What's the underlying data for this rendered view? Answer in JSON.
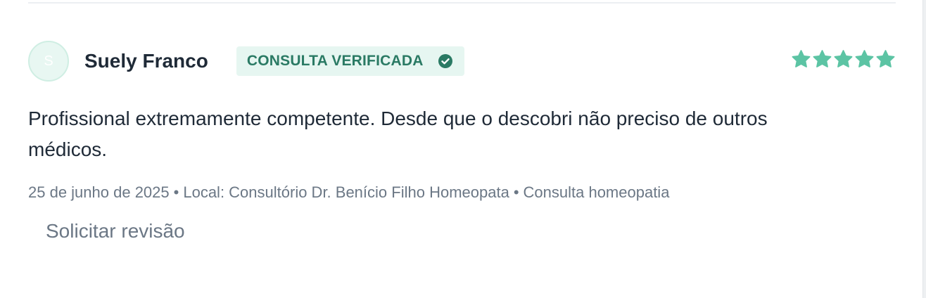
{
  "review": {
    "avatar_initial": "S",
    "author": "Suely Franco",
    "badge_label": "CONSULTA VERIFICADA",
    "rating": 5,
    "rating_max": 5,
    "text": "Profissional extremamente competente. Desde que o descobri não preciso de outros médicos.",
    "date": "25 de junho de 2025",
    "separator": "•",
    "location": "Local: Consultório Dr. Benício Filho Homeopata",
    "service": "Consulta homeopatia",
    "action_label": "Solicitar revisão"
  },
  "colors": {
    "accent": "#5cc4a4",
    "badge_text": "#2a7a64",
    "badge_bg": "#e6f6f1"
  },
  "icons": {
    "verified": "check-circle-icon",
    "rating": "star-icon"
  }
}
